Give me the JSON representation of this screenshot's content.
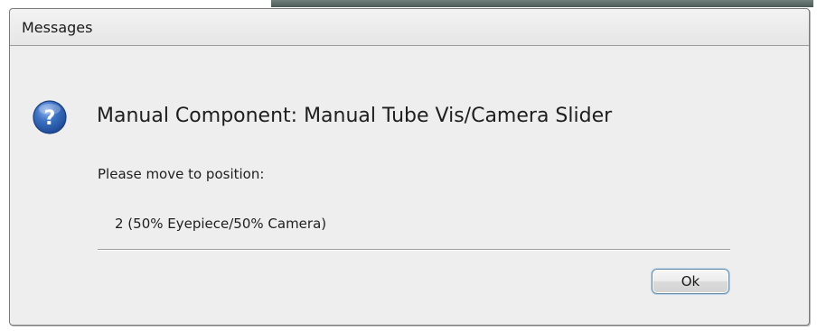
{
  "window": {
    "title": "Messages"
  },
  "message": {
    "icon": "question-icon",
    "heading": "Manual Component: Manual Tube Vis/Camera Slider",
    "instruction": "Please move to position:",
    "position_value": "2  (50% Eyepiece/50% Camera)"
  },
  "buttons": {
    "ok_label": "Ok"
  },
  "colors": {
    "icon_blue": "#2b5fb3",
    "dialog_background": "#eeeeee"
  }
}
